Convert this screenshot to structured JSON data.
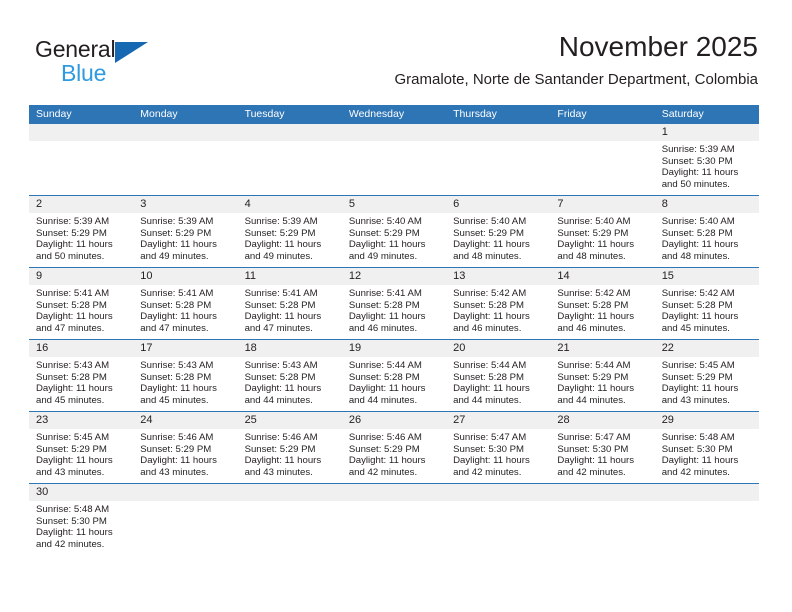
{
  "brand": {
    "name_line1": "General",
    "name_line2": "Blue",
    "flag_icon": "blue-triangle-flag",
    "color_dark": "#231f20",
    "color_blue": "#2e9ae0",
    "color_flag": "#1668b3"
  },
  "header": {
    "title": "November 2025",
    "subtitle": "Gramalote, Norte de Santander Department, Colombia"
  },
  "theme": {
    "header_bg": "#2e75b6",
    "header_text": "#ffffff",
    "daynum_bg": "#f0f0f0",
    "row_divider": "#2e75b6",
    "body_text": "#231f20"
  },
  "calendar": {
    "weekdays": [
      "Sunday",
      "Monday",
      "Tuesday",
      "Wednesday",
      "Thursday",
      "Friday",
      "Saturday"
    ],
    "weeks": [
      [
        {
          "day": "",
          "lines": []
        },
        {
          "day": "",
          "lines": []
        },
        {
          "day": "",
          "lines": []
        },
        {
          "day": "",
          "lines": []
        },
        {
          "day": "",
          "lines": []
        },
        {
          "day": "",
          "lines": []
        },
        {
          "day": "1",
          "lines": [
            "Sunrise: 5:39 AM",
            "Sunset: 5:30 PM",
            "Daylight: 11 hours",
            "and 50 minutes."
          ]
        }
      ],
      [
        {
          "day": "2",
          "lines": [
            "Sunrise: 5:39 AM",
            "Sunset: 5:29 PM",
            "Daylight: 11 hours",
            "and 50 minutes."
          ]
        },
        {
          "day": "3",
          "lines": [
            "Sunrise: 5:39 AM",
            "Sunset: 5:29 PM",
            "Daylight: 11 hours",
            "and 49 minutes."
          ]
        },
        {
          "day": "4",
          "lines": [
            "Sunrise: 5:39 AM",
            "Sunset: 5:29 PM",
            "Daylight: 11 hours",
            "and 49 minutes."
          ]
        },
        {
          "day": "5",
          "lines": [
            "Sunrise: 5:40 AM",
            "Sunset: 5:29 PM",
            "Daylight: 11 hours",
            "and 49 minutes."
          ]
        },
        {
          "day": "6",
          "lines": [
            "Sunrise: 5:40 AM",
            "Sunset: 5:29 PM",
            "Daylight: 11 hours",
            "and 48 minutes."
          ]
        },
        {
          "day": "7",
          "lines": [
            "Sunrise: 5:40 AM",
            "Sunset: 5:29 PM",
            "Daylight: 11 hours",
            "and 48 minutes."
          ]
        },
        {
          "day": "8",
          "lines": [
            "Sunrise: 5:40 AM",
            "Sunset: 5:28 PM",
            "Daylight: 11 hours",
            "and 48 minutes."
          ]
        }
      ],
      [
        {
          "day": "9",
          "lines": [
            "Sunrise: 5:41 AM",
            "Sunset: 5:28 PM",
            "Daylight: 11 hours",
            "and 47 minutes."
          ]
        },
        {
          "day": "10",
          "lines": [
            "Sunrise: 5:41 AM",
            "Sunset: 5:28 PM",
            "Daylight: 11 hours",
            "and 47 minutes."
          ]
        },
        {
          "day": "11",
          "lines": [
            "Sunrise: 5:41 AM",
            "Sunset: 5:28 PM",
            "Daylight: 11 hours",
            "and 47 minutes."
          ]
        },
        {
          "day": "12",
          "lines": [
            "Sunrise: 5:41 AM",
            "Sunset: 5:28 PM",
            "Daylight: 11 hours",
            "and 46 minutes."
          ]
        },
        {
          "day": "13",
          "lines": [
            "Sunrise: 5:42 AM",
            "Sunset: 5:28 PM",
            "Daylight: 11 hours",
            "and 46 minutes."
          ]
        },
        {
          "day": "14",
          "lines": [
            "Sunrise: 5:42 AM",
            "Sunset: 5:28 PM",
            "Daylight: 11 hours",
            "and 46 minutes."
          ]
        },
        {
          "day": "15",
          "lines": [
            "Sunrise: 5:42 AM",
            "Sunset: 5:28 PM",
            "Daylight: 11 hours",
            "and 45 minutes."
          ]
        }
      ],
      [
        {
          "day": "16",
          "lines": [
            "Sunrise: 5:43 AM",
            "Sunset: 5:28 PM",
            "Daylight: 11 hours",
            "and 45 minutes."
          ]
        },
        {
          "day": "17",
          "lines": [
            "Sunrise: 5:43 AM",
            "Sunset: 5:28 PM",
            "Daylight: 11 hours",
            "and 45 minutes."
          ]
        },
        {
          "day": "18",
          "lines": [
            "Sunrise: 5:43 AM",
            "Sunset: 5:28 PM",
            "Daylight: 11 hours",
            "and 44 minutes."
          ]
        },
        {
          "day": "19",
          "lines": [
            "Sunrise: 5:44 AM",
            "Sunset: 5:28 PM",
            "Daylight: 11 hours",
            "and 44 minutes."
          ]
        },
        {
          "day": "20",
          "lines": [
            "Sunrise: 5:44 AM",
            "Sunset: 5:28 PM",
            "Daylight: 11 hours",
            "and 44 minutes."
          ]
        },
        {
          "day": "21",
          "lines": [
            "Sunrise: 5:44 AM",
            "Sunset: 5:29 PM",
            "Daylight: 11 hours",
            "and 44 minutes."
          ]
        },
        {
          "day": "22",
          "lines": [
            "Sunrise: 5:45 AM",
            "Sunset: 5:29 PM",
            "Daylight: 11 hours",
            "and 43 minutes."
          ]
        }
      ],
      [
        {
          "day": "23",
          "lines": [
            "Sunrise: 5:45 AM",
            "Sunset: 5:29 PM",
            "Daylight: 11 hours",
            "and 43 minutes."
          ]
        },
        {
          "day": "24",
          "lines": [
            "Sunrise: 5:46 AM",
            "Sunset: 5:29 PM",
            "Daylight: 11 hours",
            "and 43 minutes."
          ]
        },
        {
          "day": "25",
          "lines": [
            "Sunrise: 5:46 AM",
            "Sunset: 5:29 PM",
            "Daylight: 11 hours",
            "and 43 minutes."
          ]
        },
        {
          "day": "26",
          "lines": [
            "Sunrise: 5:46 AM",
            "Sunset: 5:29 PM",
            "Daylight: 11 hours",
            "and 42 minutes."
          ]
        },
        {
          "day": "27",
          "lines": [
            "Sunrise: 5:47 AM",
            "Sunset: 5:30 PM",
            "Daylight: 11 hours",
            "and 42 minutes."
          ]
        },
        {
          "day": "28",
          "lines": [
            "Sunrise: 5:47 AM",
            "Sunset: 5:30 PM",
            "Daylight: 11 hours",
            "and 42 minutes."
          ]
        },
        {
          "day": "29",
          "lines": [
            "Sunrise: 5:48 AM",
            "Sunset: 5:30 PM",
            "Daylight: 11 hours",
            "and 42 minutes."
          ]
        }
      ],
      [
        {
          "day": "30",
          "lines": [
            "Sunrise: 5:48 AM",
            "Sunset: 5:30 PM",
            "Daylight: 11 hours",
            "and 42 minutes."
          ]
        },
        {
          "day": "",
          "lines": []
        },
        {
          "day": "",
          "lines": []
        },
        {
          "day": "",
          "lines": []
        },
        {
          "day": "",
          "lines": []
        },
        {
          "day": "",
          "lines": []
        },
        {
          "day": "",
          "lines": []
        }
      ]
    ]
  }
}
